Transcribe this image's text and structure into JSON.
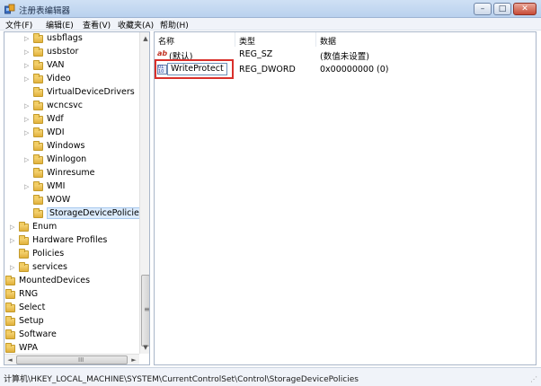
{
  "window": {
    "title": "注册表编辑器",
    "minimize_glyph": "–",
    "maximize_glyph": "□",
    "close_glyph": "✕"
  },
  "menu": {
    "items": [
      "文件(F)",
      "编辑(E)",
      "查看(V)",
      "收藏夹(A)",
      "帮助(H)"
    ]
  },
  "tree": {
    "items": [
      {
        "label": "usbflags",
        "expander": "▷"
      },
      {
        "label": "usbstor",
        "expander": "▷"
      },
      {
        "label": "VAN",
        "expander": "▷"
      },
      {
        "label": "Video",
        "expander": "▷"
      },
      {
        "label": "VirtualDeviceDrivers",
        "expander": ""
      },
      {
        "label": "wcncsvc",
        "expander": "▷"
      },
      {
        "label": "Wdf",
        "expander": "▷"
      },
      {
        "label": "WDI",
        "expander": "▷"
      },
      {
        "label": "Windows",
        "expander": ""
      },
      {
        "label": "Winlogon",
        "expander": "▷"
      },
      {
        "label": "Winresume",
        "expander": ""
      },
      {
        "label": "WMI",
        "expander": "▷"
      },
      {
        "label": "WOW",
        "expander": ""
      },
      {
        "label": "StorageDevicePolicies",
        "expander": "",
        "selected": true
      },
      {
        "label": "Enum",
        "expander": "▷"
      },
      {
        "label": "Hardware Profiles",
        "expander": "▷"
      },
      {
        "label": "Policies",
        "expander": ""
      },
      {
        "label": "services",
        "expander": "▷"
      },
      {
        "label": "MountedDevices",
        "expander": ""
      },
      {
        "label": "RNG",
        "expander": ""
      },
      {
        "label": "Select",
        "expander": ""
      },
      {
        "label": "Setup",
        "expander": ""
      },
      {
        "label": "Software",
        "expander": ""
      },
      {
        "label": "WPA",
        "expander": ""
      }
    ],
    "scroll_up": "▲",
    "scroll_down": "▼",
    "scroll_left": "◄",
    "scroll_right": "►",
    "hscroll_grip": "III",
    "vscroll_grip": "≡"
  },
  "list": {
    "columns": {
      "name": "名称",
      "type": "类型",
      "data": "数据"
    },
    "rows": [
      {
        "name": "(默认)",
        "type": "REG_SZ",
        "data": "(数值未设置)",
        "icon": "string-value-icon"
      },
      {
        "name": "WriteProtect",
        "type": "REG_DWORD",
        "data": "0x00000000 (0)",
        "icon": "binary-value-icon",
        "editing": true
      }
    ],
    "string_icon_text": "ab"
  },
  "status": {
    "path": "计算机\\HKEY_LOCAL_MACHINE\\SYSTEM\\CurrentControlSet\\Control\\StorageDevicePolicies"
  },
  "colors": {
    "highlight_border": "#d9302b",
    "selection_bg": "#dcebfc",
    "folder": "#f2cd63"
  }
}
